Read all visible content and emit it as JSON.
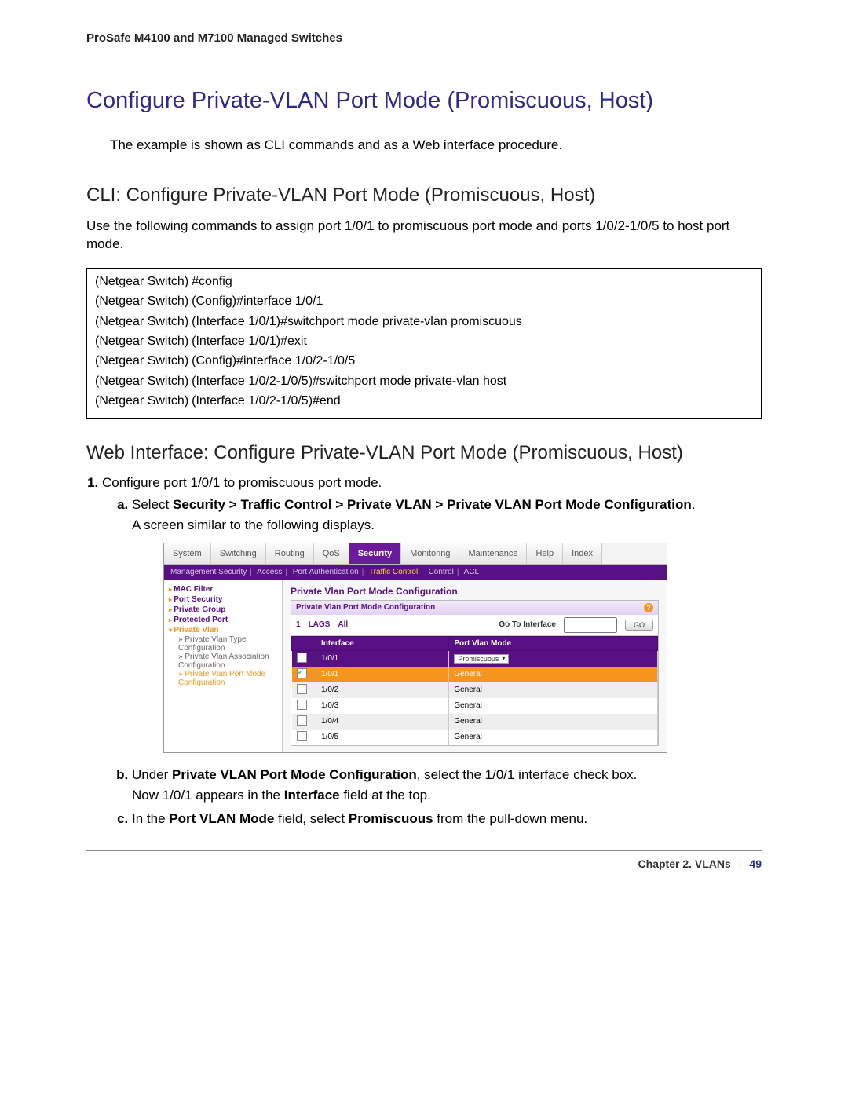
{
  "header": "ProSafe M4100 and M7100 Managed Switches",
  "title": "Configure Private-VLAN Port Mode (Promiscuous, Host)",
  "intro": "The example is shown as CLI commands and as a Web interface procedure.",
  "cli_heading": "CLI: Configure Private-VLAN Port Mode (Promiscuous, Host)",
  "cli_intro": "Use the following commands to assign port 1/0/1 to promiscuous port mode and ports 1/0/2-1/0/5 to host port mode.",
  "cli_lines": [
    {
      "prompt": "(Netgear Switch)",
      "cmd": "#config"
    },
    {
      "prompt": "(Netgear Switch)",
      "cmd": "(Config)#interface 1/0/1"
    },
    {
      "prompt": "(Netgear Switch)",
      "cmd": "(Interface 1/0/1)#switchport mode private-vlan promiscuous"
    },
    {
      "prompt": "(Netgear Switch)",
      "cmd": "(Interface 1/0/1)#exit"
    },
    {
      "prompt": "(Netgear Switch)",
      "cmd": "(Config)#interface 1/0/2-1/0/5"
    },
    {
      "prompt": "(Netgear Switch)",
      "cmd": "(Interface 1/0/2-1/0/5)#switchport mode private-vlan host"
    },
    {
      "prompt": "(Netgear Switch)",
      "cmd": "(Interface 1/0/2-1/0/5)#end"
    }
  ],
  "web_heading": "Web Interface: Configure Private-VLAN Port Mode (Promiscuous, Host)",
  "steps": {
    "s1": "Configure port 1/0/1 to promiscuous port mode.",
    "a_prefix": "Select ",
    "a_bold": "Security > Traffic Control > Private VLAN > Private VLAN Port Mode Configuration",
    "a_suffix": ".",
    "a_after": "A screen similar to the following displays.",
    "b_prefix": "Under ",
    "b_bold": "Private VLAN Port Mode Configuration",
    "b_suffix": ", select the 1/0/1 interface check box.",
    "b_after_pre": "Now 1/0/1 appears in the ",
    "b_after_bold": "Interface",
    "b_after_post": " field at the top.",
    "c_pre": "In the ",
    "c_b1": "Port VLAN Mode",
    "c_mid": " field, select ",
    "c_b2": "Promiscuous",
    "c_post": " from the pull-down menu."
  },
  "tabs": [
    "System",
    "Switching",
    "Routing",
    "QoS",
    "Security",
    "Monitoring",
    "Maintenance",
    "Help",
    "Index"
  ],
  "subtabs": {
    "items": [
      "Management Security",
      "Access",
      "Port Authentication",
      "Traffic Control",
      "Control",
      "ACL"
    ],
    "active": "Traffic Control"
  },
  "sidebar": {
    "mac": "MAC Filter",
    "portsec": "Port Security",
    "pg": "Private Group",
    "pp": "Protected Port",
    "pv": "Private Vlan",
    "pvt": "Private Vlan Type Configuration",
    "pva": "Private Vlan Association Configuration",
    "pvpm": "Private Vlan Port Mode Configuration"
  },
  "panel": {
    "page_title": "Private Vlan Port Mode Configuration",
    "panel_title": "Private Vlan Port Mode Configuration",
    "toolbar": {
      "l1": "1",
      "l2": "LAGS",
      "l3": "All",
      "go_label": "Go To Interface",
      "go_btn": "GO"
    },
    "cols": {
      "iface": "Interface",
      "mode": "Port Vlan Mode"
    },
    "edit": {
      "iface": "1/0/1",
      "mode": "Promiscuous"
    },
    "rows": [
      {
        "iface": "1/0/1",
        "mode": "General",
        "sel": true
      },
      {
        "iface": "1/0/2",
        "mode": "General",
        "sel": false
      },
      {
        "iface": "1/0/3",
        "mode": "General",
        "sel": false
      },
      {
        "iface": "1/0/4",
        "mode": "General",
        "sel": false
      },
      {
        "iface": "1/0/5",
        "mode": "General",
        "sel": false
      }
    ]
  },
  "footer": {
    "chapter": "Chapter 2.  VLANs",
    "page": "49"
  }
}
